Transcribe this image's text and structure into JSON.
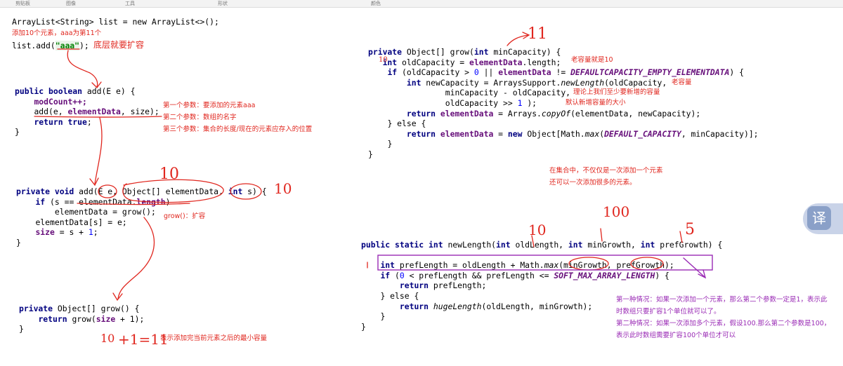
{
  "toolbar": {
    "labels": [
      "剪贴板",
      "图像",
      "工具",
      "形状",
      "颜色"
    ]
  },
  "code": {
    "decl": "ArrayList<String> list = new ArrayList<>();",
    "add_call_prefix": "list.add(",
    "add_call_string": "\"aaa\"",
    "add_call_suffix": ");",
    "add_method": {
      "sig_kw": "public boolean",
      "sig_rest": "add(E e) {",
      "line1": "modCount++;",
      "line2_pre": "add(e, ",
      "line2_field": "elementData",
      "line2_post": ", size);",
      "line3_kw": "return true",
      "line3_end": ";",
      "close": "}"
    },
    "helper_method": {
      "sig_kw": "private void",
      "sig_pre": "add(E e, Object[] elementData, ",
      "sig_int": "int",
      "sig_post": " s) {",
      "line1_kw": "if",
      "line1_pre": " (s == elementData.",
      "line1_field": "length",
      "line1_post": ")",
      "line2": "elementData = grow();",
      "line3": "elementData[s] = e;",
      "line4_pre": "s + ",
      "line4_num": "1",
      "line4_post": ";",
      "size_var": "size",
      "close": "}"
    },
    "grow_noarg": {
      "sig_kw": "private",
      "sig_rest": "Object[] grow() {",
      "line1_kw": "return",
      "line1_pre": "grow(",
      "line1_field": "size",
      "line1_post": " + 1);",
      "close": "}"
    },
    "grow_arg": {
      "sig_kw": "private",
      "sig_rest": "Object[] grow(",
      "sig_int": "int",
      "sig_post": " minCapacity) {",
      "line1_int": "int",
      "line1_pre": " oldCapacity = ",
      "line1_field": "elementData",
      "line1_post": ".length;",
      "line2_pre": " (oldCapacity > ",
      "line2_num": "0",
      "line2_mid": " || ",
      "line2_field": "elementData",
      "line2_mid2": " != ",
      "line2_const": "DEFAULTCAPACITY_EMPTY_ELEMENTDATA",
      "line2_post": ") {",
      "line3_pre": " newCapacity = ArraysSupport.",
      "line3_method": "newLength",
      "line3_post": "(oldCapacity,",
      "line4": "minCapacity - oldCapacity,",
      "line5_pre": "oldCapacity >> ",
      "line5_num": "1",
      "line5_post": " );",
      "line6_kw": "return",
      "line6_pre": " ",
      "line6_field": "elementData",
      "line6_mid": " = Arrays.",
      "line6_method": "copyOf",
      "line6_post": "(elementData, newCapacity);",
      "else_line": "} else {",
      "line7_kw": "return",
      "line7_pre": " ",
      "line7_field": "elementData",
      "line7_mid": " = ",
      "line7_new": "new",
      "line7_mid2": " Object[Math.",
      "line7_method": "max",
      "line7_mid3": "(",
      "line7_const": "DEFAULT_CAPACITY",
      "line7_post": ", minCapacity)];",
      "close1": "}",
      "close2": "}"
    },
    "new_length": {
      "sig_kw": "public static int",
      "sig_pre": " newLength(",
      "sig_int1": "int",
      "sig_mid1": " oldLength, ",
      "sig_int2": "int",
      "sig_mid2": " minGrowth, ",
      "sig_int3": "int",
      "sig_post": " prefGrowth) {",
      "line1_int": "int",
      "line1_pre": " prefLength = oldLength + Math.",
      "line1_method": "max",
      "line1_post": "(minGrowth, prefGrowth);",
      "line2_kw": "if",
      "line2_pre": " (",
      "line2_num": "0",
      "line2_post": " < prefLength && prefLength <= ",
      "line2_const": "SOFT_MAX_ARRAY_LENGTH",
      "line2_end": ") {",
      "line3_kw": "return",
      "line3_post": " prefLength;",
      "else_line": "} else {",
      "line4_kw": "return",
      "line4_method": "hugeLength",
      "line4_post": "(oldLength, minGrowth);",
      "close1": "}",
      "close2": "}"
    }
  },
  "annotations": {
    "add_10": "添加10个元素，aaa为第11个",
    "expand": "底层就要扩容",
    "param1": "第一个参数：要添加的元素aaa",
    "param2": "第二个参数：数组的名字",
    "param3": "第三个参数：集合的长度/现在的元素应存入的位置",
    "grow_hint": "grow()：扩容",
    "min_capacity": "表示添加完当前元素之后的最小容量",
    "old_capacity": "老容量就是10",
    "old_capacity_2": "老容量",
    "theory_min": "理论上我们至少要新增的容量",
    "default_new": "默认新增容量的大小",
    "collection_1": "在集合中，不仅仅是一次添加一个元素",
    "collection_2": "还可以一次添加很多的元素。",
    "case1_a": "第一种情况：如果一次添加一个元素，那么第二个参数一定是1，表示此",
    "case1_b": "时数组只要扩容1个单位就可以了。",
    "case2_a": "第二种情况：如果一次添加多个元素，假设100.那么第二个参数是100，",
    "case2_b": "表示此时数组需要扩容100个单位才可以"
  },
  "handwriting": {
    "eleven": "11",
    "ten_a": "10",
    "ten_b": "10",
    "ten_small": "10",
    "ten_c": "10",
    "hundred": "100",
    "ten_d": "10",
    "five": "5",
    "ten_e": "10",
    "plus_one": "+1=11"
  },
  "translate_button": {
    "label": "译"
  },
  "colors": {
    "annotation": "#e0261e",
    "annotation_purple": "#9a2bb5",
    "keyword": "#000080",
    "field": "#660e7a"
  }
}
